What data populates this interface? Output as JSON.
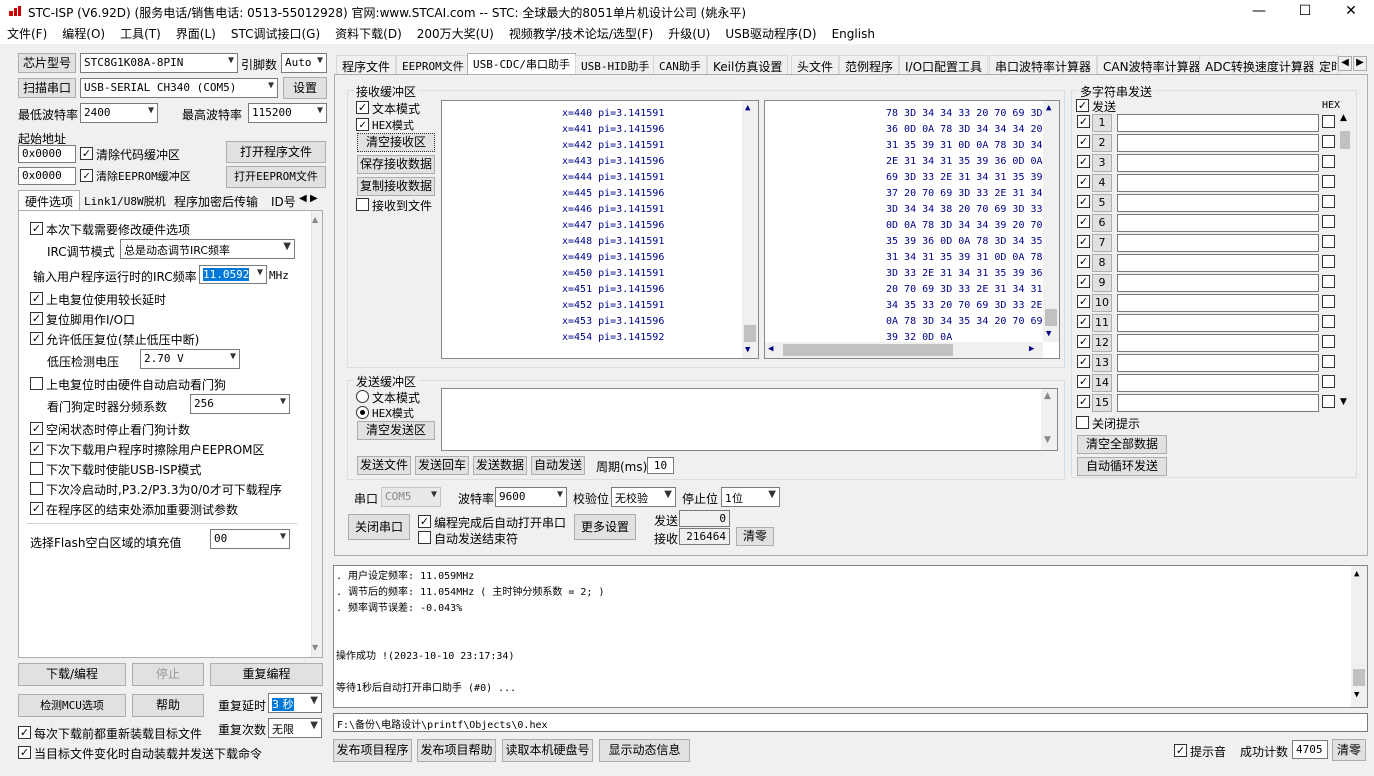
{
  "window": {
    "title": "STC-ISP (V6.92D) (服务电话/销售电话: 0513-55012928) 官网:www.STCAI.com  -- STC: 全球最大的8051单片机设计公司 (姚永平)",
    "min": "—",
    "max": "☐",
    "close": "✕"
  },
  "menu": [
    "文件(F)",
    "编程(O)",
    "工具(T)",
    "界面(L)",
    "STC调试接口(G)",
    "资料下载(D)",
    "200万大奖(U)",
    "视频教学/技术论坛/选型(F)",
    "升级(U)",
    "USB驱动程序(D)",
    "English"
  ],
  "left": {
    "chip_btn": "芯片型号",
    "chip_value": "STC8G1K08A-8PIN",
    "pins_label": "引脚数",
    "pins_value": "Auto",
    "scan_btn": "扫描串口",
    "port_value": "USB-SERIAL CH340 (COM5)",
    "settings_btn": "设置",
    "min_baud_label": "最低波特率",
    "min_baud": "2400",
    "max_baud_label": "最高波特率",
    "max_baud": "115200",
    "start_addr_label": "起始地址",
    "addr1": "0x0000",
    "clear_code": "清除代码缓冲区",
    "open_prog": "打开程序文件",
    "addr2": "0x0000",
    "clear_eeprom": "清除EEPROM缓冲区",
    "open_eeprom": "打开EEPROM文件",
    "tabs": [
      "硬件选项",
      "Link1/U8W脱机",
      "程序加密后传输",
      "ID号"
    ],
    "opt_irc_change": "本次下载需要修改硬件选项",
    "irc_mode_label": "IRC调节模式",
    "irc_mode": "总是动态调节IRC频率",
    "irc_freq_label": "输入用户程序运行时的IRC频率",
    "irc_freq": "11.0592",
    "irc_unit": "MHz",
    "opt_long_delay": "上电复位使用较长延时",
    "opt_reset_io": "复位脚用作I/O口",
    "opt_low_v": "允许低压复位(禁止低压中断)",
    "lowv_label": "低压检测电压",
    "lowv": "2.70 V",
    "opt_wdt": "上电复位时由硬件自动启动看门狗",
    "wdt_div_label": "看门狗定时器分频系数",
    "wdt_div": "256",
    "opt_idle_wdt": "空闲状态时停止看门狗计数",
    "opt_erase_eeprom": "下次下载用户程序时擦除用户EEPROM区",
    "opt_usb_isp": "下次下载时使能USB-ISP模式",
    "opt_p32": "下次冷启动时,P3.2/P3.3为0/0才可下载程序",
    "opt_test_params": "在程序区的结束处添加重要测试参数",
    "fill_label": "选择Flash空白区域的填充值",
    "fill_value": "00",
    "download_btn": "下载/编程",
    "stop_btn": "停止",
    "reprog_btn": "重复编程",
    "check_mcu_btn": "检测MCU选项",
    "help_btn": "帮助",
    "retry_delay_label": "重复延时",
    "retry_delay": "3 秒",
    "retry_count_label": "重复次数",
    "retry_count": "无限",
    "reload_each": "每次下载前都重新装载目标文件",
    "auto_reload": "当目标文件变化时自动装载并发送下载命令"
  },
  "tabs": [
    "程序文件",
    "EEPROM文件",
    "USB-CDC/串口助手",
    "USB-HID助手",
    "CAN助手",
    "Keil仿真设置",
    "头文件",
    "范例程序",
    "I/O口配置工具",
    "串口波特率计算器",
    "CAN波特率计算器",
    "ADC转换速度计算器",
    "定时"
  ],
  "recv": {
    "group": "接收缓冲区",
    "text_mode": "文本模式",
    "hex_mode": "HEX模式",
    "clear_btn": "清空接收区",
    "save_btn": "保存接收数据",
    "copy_btn": "复制接收数据",
    "to_file": "接收到文件",
    "lines": [
      "x=440 pi=3.141591",
      "x=441 pi=3.141596",
      "x=442 pi=3.141591",
      "x=443 pi=3.141596",
      "x=444 pi=3.141591",
      "x=445 pi=3.141596",
      "x=446 pi=3.141591",
      "x=447 pi=3.141596",
      "x=448 pi=3.141591",
      "x=449 pi=3.141596",
      "x=450 pi=3.141591",
      "x=451 pi=3.141596",
      "x=452 pi=3.141591",
      "x=453 pi=3.141596",
      "x=454 pi=3.141592"
    ],
    "hex": [
      "78 3D 34 34 33 20 70 69 3D",
      "36 0D 0A 78 3D 34 34 34 20",
      "31 35 39 31 0D 0A 78 3D 34",
      "2E 31 34 31 35 39 36 0D 0A",
      "69 3D 33 2E 31 34 31 35 39",
      "37 20 70 69 3D 33 2E 31 34",
      "3D 34 34 38 20 70 69 3D 33",
      "0D 0A 78 3D 34 34 39 20 70",
      "35 39 36 0D 0A 78 3D 34 35",
      "31 34 31 35 39 31 0D 0A 78",
      "3D 33 2E 31 34 31 35 39 36",
      "20 70 69 3D 33 2E 31 34 31",
      "34 35 33 20 70 69 3D 33 2E",
      "0A 78 3D 34 35 34 20 70 69",
      "39 32 0D 0A"
    ]
  },
  "send": {
    "group": "发送缓冲区",
    "text_mode": "文本模式",
    "hex_mode": "HEX模式",
    "clear_btn": "清空发送区",
    "send_file": "发送文件",
    "send_enter": "发送回车",
    "send_data": "发送数据",
    "auto_send": "自动发送",
    "period_label": "周期(ms)",
    "period": "10"
  },
  "serial": {
    "port_label": "串口",
    "port": "COM5",
    "baud_label": "波特率",
    "baud": "9600",
    "parity_label": "校验位",
    "parity": "无校验",
    "stop_label": "停止位",
    "stop": "1位",
    "close_btn": "关闭串口",
    "auto_open": "编程完成后自动打开串口",
    "auto_end": "自动发送结束符",
    "more_btn": "更多设置",
    "send_label": "发送",
    "send_count": "0",
    "recv_label": "接收",
    "recv_count": "216464",
    "clear_btn": "清零"
  },
  "multi": {
    "group": "多字符串发送",
    "send_hdr": "发送",
    "hex_hdr": "HEX",
    "rows": [
      "1",
      "2",
      "3",
      "4",
      "5",
      "6",
      "7",
      "8",
      "9",
      "10",
      "11",
      "12",
      "13",
      "14",
      "15"
    ],
    "close_tip": "关闭提示",
    "clear_all": "清空全部数据",
    "auto_loop": "自动循环发送"
  },
  "log": {
    "lines": [
      ". 用户设定频率: 11.059MHz",
      ". 调节后的频率: 11.054MHz ( 主时钟分频系数 = 2; )",
      ". 频率调节误差: -0.043%",
      "",
      "",
      "操作成功 !(2023-10-10 23:17:34)",
      "",
      "等待1秒后自动打开串口助手 (#0) ..."
    ]
  },
  "path": "F:\\备份\\电路设计\\printf\\Objects\\0.hex",
  "bottom": {
    "publish_prog": "发布项目程序",
    "publish_help": "发布项目帮助",
    "read_disk": "读取本机硬盘号",
    "show_dynamic": "显示动态信息",
    "tip_sound": "提示音",
    "success_label": "成功计数",
    "success_count": "4705",
    "clear_btn": "清零"
  },
  "colors": {
    "hex_text": "#00008b",
    "title_bg": "#ffffff",
    "selection": "#0078d7"
  }
}
